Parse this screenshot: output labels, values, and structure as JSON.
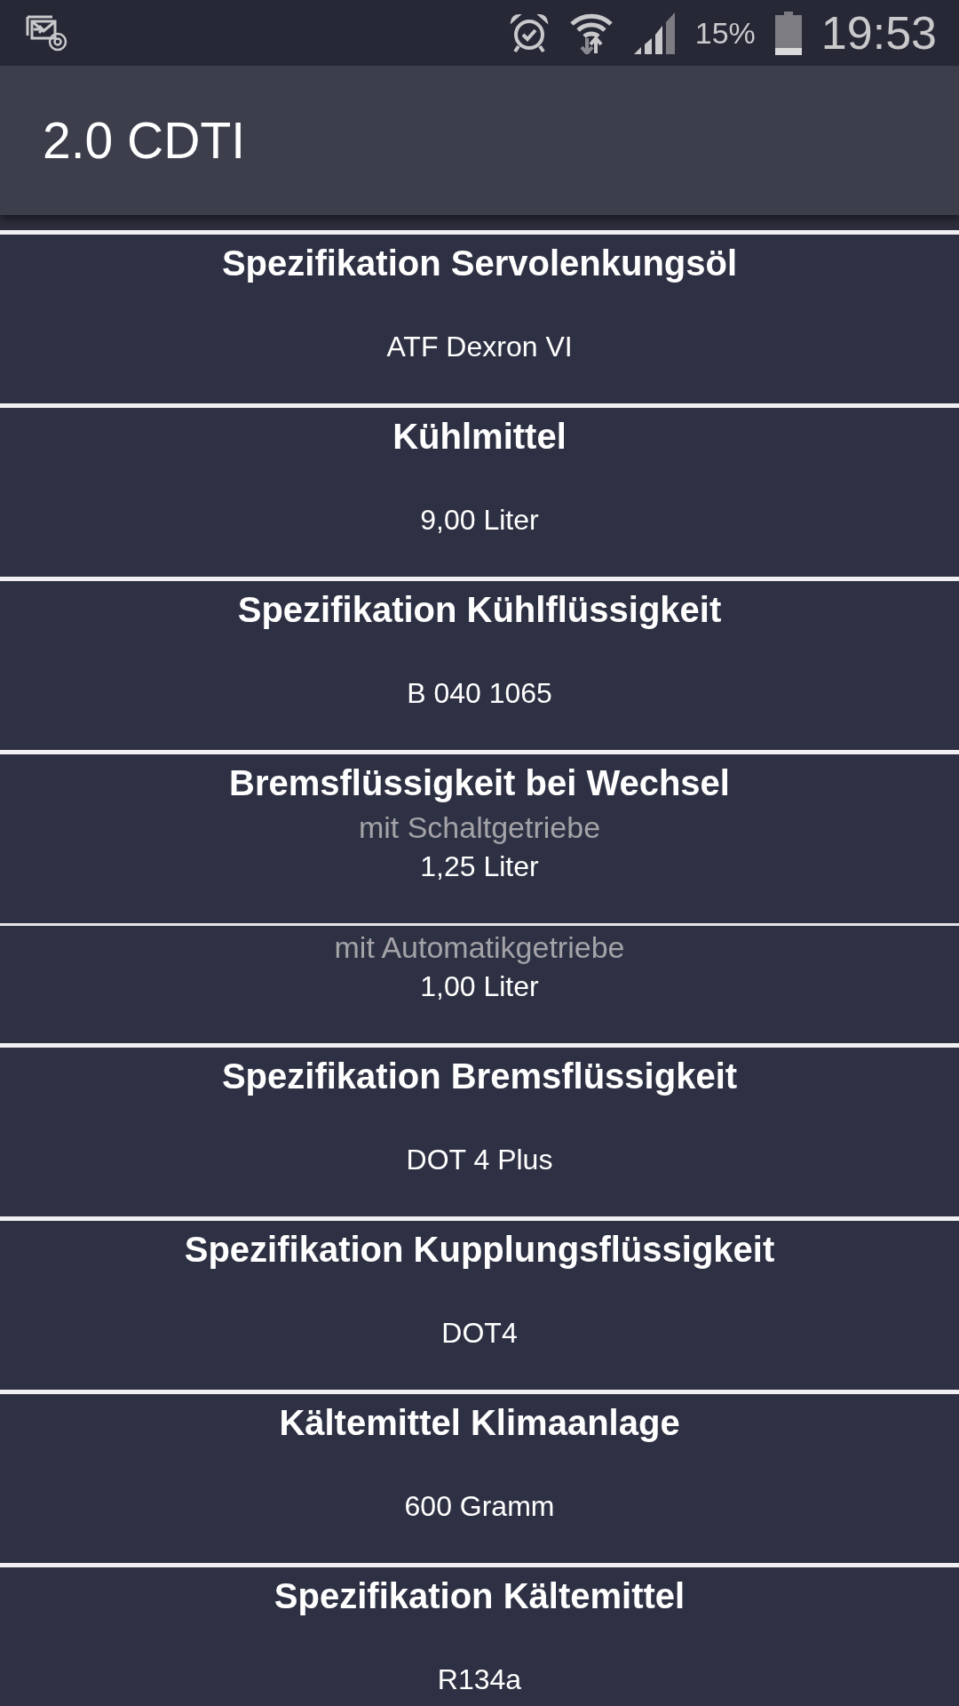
{
  "status_bar": {
    "battery_percent": "15%",
    "time": "19:53"
  },
  "app_bar": {
    "title": "2.0 CDTI"
  },
  "specs": [
    {
      "title": "Spezifikation Servolenkungsöl",
      "entries": [
        {
          "value": "ATF Dexron VI"
        }
      ]
    },
    {
      "title": "Kühlmittel",
      "entries": [
        {
          "value": "9,00 Liter"
        }
      ]
    },
    {
      "title": "Spezifikation Kühlflüssigkeit",
      "entries": [
        {
          "value": "B 040 1065"
        }
      ]
    },
    {
      "title": "Bremsflüssigkeit bei Wechsel",
      "entries": [
        {
          "label": "mit Schaltgetriebe",
          "value": "1,25 Liter"
        },
        {
          "label": "mit Automatikgetriebe",
          "value": "1,00 Liter"
        }
      ]
    },
    {
      "title": "Spezifikation Bremsflüssigkeit",
      "entries": [
        {
          "value": "DOT 4 Plus"
        }
      ]
    },
    {
      "title": "Spezifikation Kupplungsflüssigkeit",
      "entries": [
        {
          "value": "DOT4"
        }
      ]
    },
    {
      "title": "Kältemittel Klimaanlage",
      "entries": [
        {
          "value": "600 Gramm"
        }
      ]
    },
    {
      "title": "Spezifikation Kältemittel",
      "entries": [
        {
          "value": "R134a"
        }
      ]
    }
  ]
}
